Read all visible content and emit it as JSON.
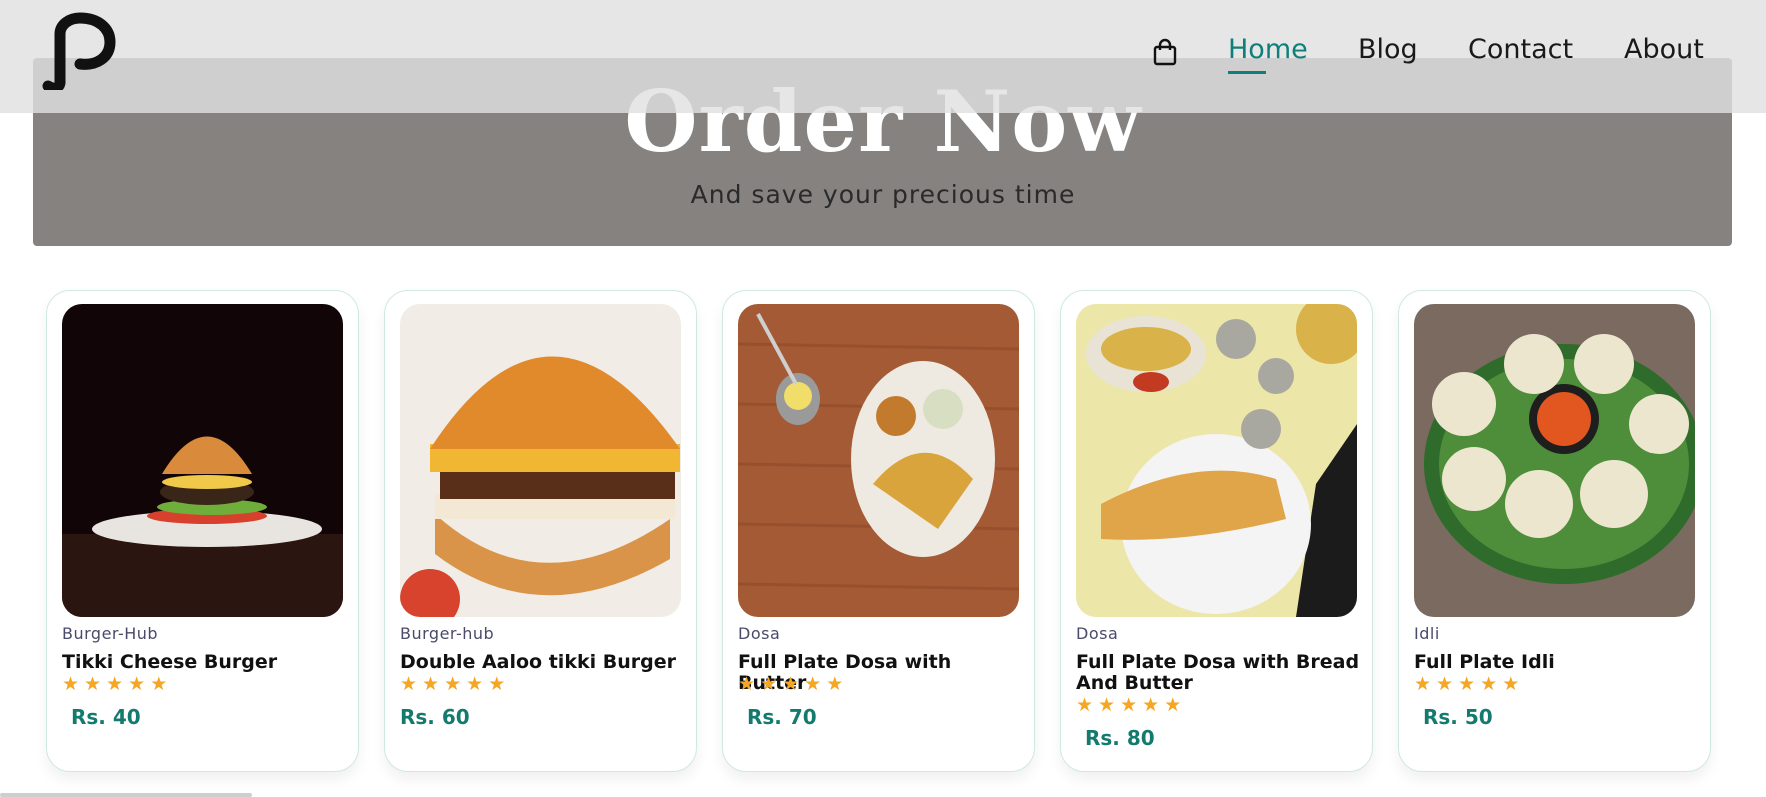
{
  "nav": {
    "links": [
      {
        "label": "Home",
        "active": true
      },
      {
        "label": "Blog",
        "active": false
      },
      {
        "label": "Contact",
        "active": false
      },
      {
        "label": "About",
        "active": false
      }
    ],
    "cart_icon": "shopping-bag-icon",
    "logo": "p-logo"
  },
  "hero": {
    "title": "Order Now",
    "subtitle": "And save your precious time"
  },
  "products": [
    {
      "category": "Burger-Hub",
      "name": "Tikki Cheese Burger",
      "price": "Rs. 40",
      "rating": 5
    },
    {
      "category": "Burger-hub",
      "name": "Double Aaloo tikki Burger",
      "price": "Rs. 60",
      "rating": 5
    },
    {
      "category": "Dosa",
      "name": "Full Plate Dosa with Butter",
      "price": "Rs. 70",
      "rating": 5
    },
    {
      "category": "Dosa",
      "name": "Full Plate Dosa with Bread And Butter",
      "price": "Rs. 80",
      "rating": 5
    },
    {
      "category": "Idli",
      "name": "Full Plate Idli",
      "price": "Rs. 50",
      "rating": 5
    }
  ],
  "colors": {
    "accent": "#0f7f7a",
    "price": "#157a6e",
    "star": "#f5a623",
    "hero_bg": "#858280"
  }
}
